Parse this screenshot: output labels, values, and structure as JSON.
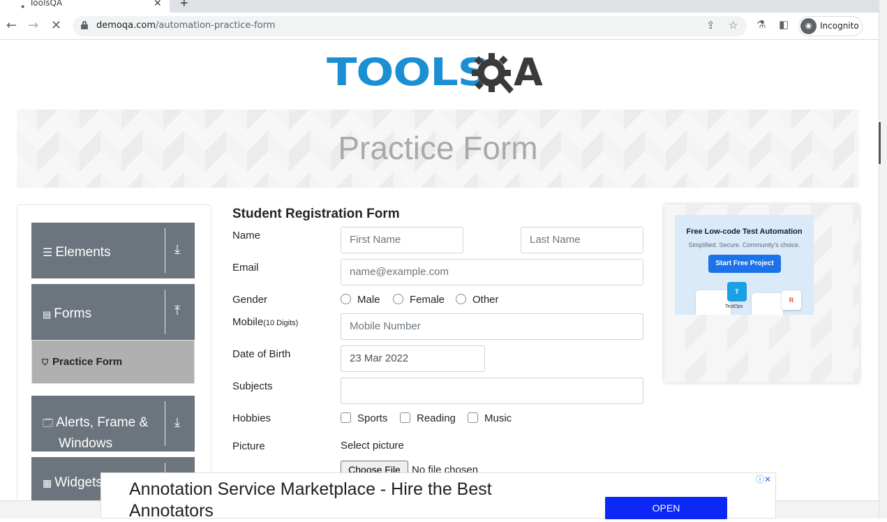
{
  "browser": {
    "tab_title": "ToolsQA",
    "url_host": "demoqa.com",
    "url_path": "/automation-practice-form",
    "profile_label": "Incognito"
  },
  "logo": {
    "part1": "TOOLS",
    "part2": "A"
  },
  "banner": {
    "title": "Practice Form"
  },
  "sidebar": {
    "groups": [
      {
        "label": "Elements",
        "icon": "hamburger-icon",
        "arrow": "download-arrow-icon"
      },
      {
        "label": "Forms",
        "icon": "document-icon",
        "arrow": "upload-arrow-icon"
      },
      {
        "label": "Alerts, Frame &",
        "label2": "Windows",
        "icon": "window-icon",
        "arrow": "download-arrow-icon"
      },
      {
        "label": "Widgets",
        "icon": "widgets-icon"
      }
    ],
    "active_item": "Practice Form"
  },
  "form": {
    "title": "Student Registration Form",
    "name_label": "Name",
    "first_name_placeholder": "First Name",
    "last_name_placeholder": "Last Name",
    "email_label": "Email",
    "email_placeholder": "name@example.com",
    "gender_label": "Gender",
    "gender_options": [
      "Male",
      "Female",
      "Other"
    ],
    "mobile_label": "Mobile",
    "mobile_hint": "(10 Digits)",
    "mobile_placeholder": "Mobile Number",
    "dob_label": "Date of Birth",
    "dob_value": "23 Mar 2022",
    "subjects_label": "Subjects",
    "hobbies_label": "Hobbies",
    "hobby_options": [
      "Sports",
      "Reading",
      "Music"
    ],
    "picture_label": "Picture",
    "select_picture": "Select picture",
    "choose_file": "Choose File",
    "no_file": "No file chosen"
  },
  "side_ad": {
    "title": "Free Low-code Test Automation",
    "subtitle": "Simplified. Secure. Community's choice.",
    "button": "Start Free Project",
    "caption": "TestOps"
  },
  "bottom_ad": {
    "text": "Annotation Service Marketplace - Hire the Best Annotators",
    "button": "OPEN"
  }
}
